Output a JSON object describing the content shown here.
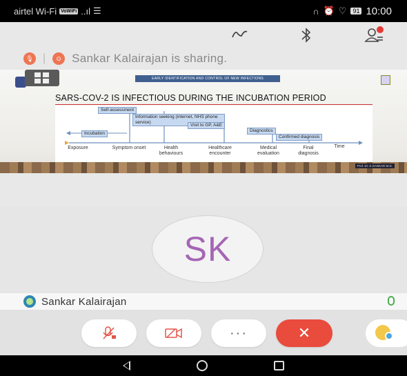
{
  "status_bar": {
    "carrier": "airtel Wi-Fi",
    "wifi_badge": "VoWiFi",
    "battery": "91",
    "time": "10:00"
  },
  "toolbar": {
    "draw_icon": "scribble-icon",
    "bluetooth_icon": "bluetooth-icon",
    "participants_icon": "participants-icon"
  },
  "share_bar": {
    "text": "Sankar Kalairajan is sharing."
  },
  "slide": {
    "header": "EARLY IDENTIFICATION AND CONTROL OF NEW INFECTIONS",
    "title": "SARS-COV-2 IS INFECTIOUS DURING THE INCUBATION PERIOD",
    "boxes": [
      "Self-assessment",
      "Information seeking (internet, NHS phone service)",
      "Visit to GP, A&E",
      "Incubation",
      "Diagnostics",
      "Confirmed diagnosis"
    ],
    "axis": [
      "Exposure",
      "Symptom onset",
      "Health behaviours",
      "Healthcare encounter",
      "Medical evaluation",
      "Final diagnosis",
      "Time"
    ],
    "credit": "Prof. Dr. K.SANKAR M.D."
  },
  "avatar": {
    "initials": "SK"
  },
  "participant": {
    "name": "Sankar Kalairajan"
  },
  "controls": {
    "more": "···",
    "end": "✕"
  }
}
